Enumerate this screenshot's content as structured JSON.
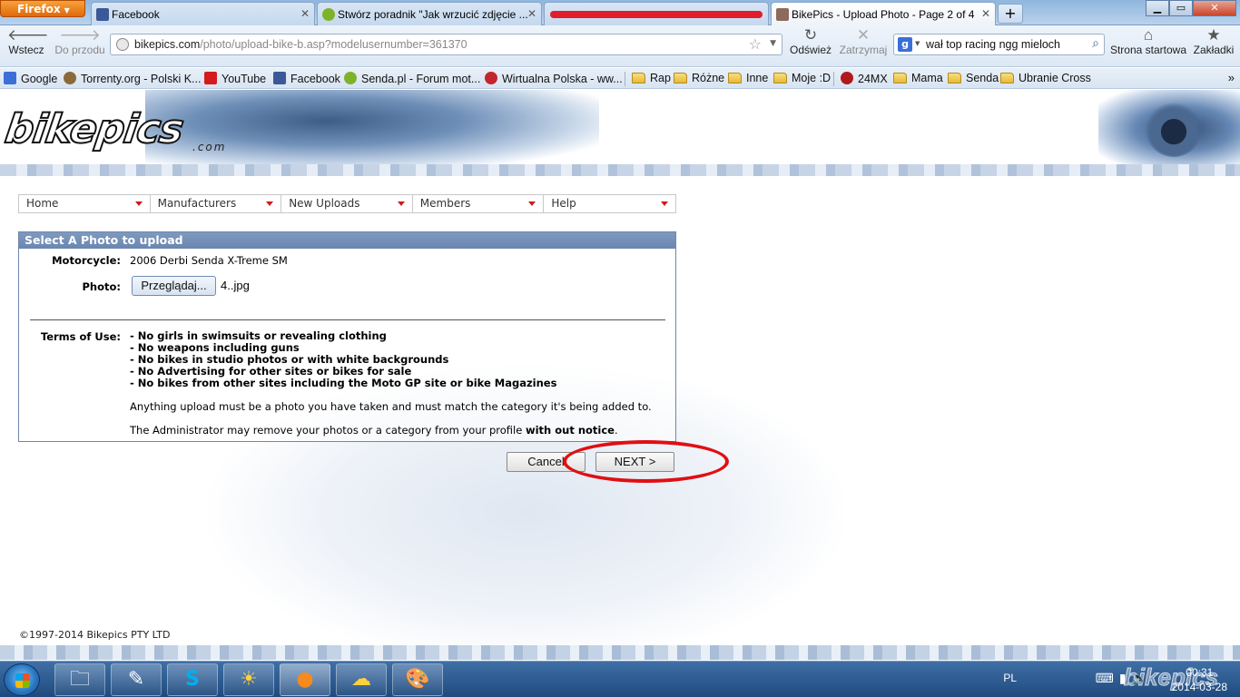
{
  "browser": {
    "app_button": "Firefox",
    "tabs": [
      {
        "title": "Facebook",
        "color": "#3b5998"
      },
      {
        "title": "Stwórz poradnik \"Jak wrzucić zdjęcie ...",
        "color": "#7db32b"
      },
      {
        "title": "",
        "color": "#e01e2c"
      },
      {
        "title": "BikePics - Upload Photo - Page 2 of 4",
        "color": "#8d6b5a"
      }
    ],
    "nav": {
      "back": "Wstecz",
      "forward": "Do przodu",
      "reload": "Odśwież",
      "stop": "Zatrzymaj",
      "home": "Strona startowa",
      "bookmarks": "Zakładki"
    },
    "url_host": "bikepics.com",
    "url_path": "/photo/upload-bike-b.asp?modelusernumber=361370",
    "search_query": "wał top racing ngg mieloch",
    "bookmarks_bar": [
      {
        "label": "Google",
        "icon": "google-icon"
      },
      {
        "label": "Torrenty.org - Polski K...",
        "icon": "torrent-icon"
      },
      {
        "label": "YouTube",
        "icon": "youtube-icon"
      },
      {
        "label": "Facebook",
        "icon": "facebook-icon"
      },
      {
        "label": "Senda.pl - Forum mot...",
        "icon": "senda-icon"
      },
      {
        "label": "Wirtualna Polska - ww...",
        "icon": "wp-icon"
      },
      {
        "label": "Rap",
        "icon": "folder-icon"
      },
      {
        "label": "Różne",
        "icon": "folder-icon"
      },
      {
        "label": "Inne",
        "icon": "folder-icon"
      },
      {
        "label": "Moje :D",
        "icon": "folder-icon"
      },
      {
        "label": "24MX",
        "icon": "24mx-icon"
      },
      {
        "label": "Mama",
        "icon": "folder-icon"
      },
      {
        "label": "Senda",
        "icon": "folder-icon"
      },
      {
        "label": "Ubranie Cross",
        "icon": "folder-icon"
      }
    ]
  },
  "site": {
    "logo": "bikepics",
    "logo_sub": ".com",
    "menu": [
      "Home",
      "Manufacturers",
      "New Uploads",
      "Members",
      "Help"
    ],
    "panel": {
      "heading": "Select A Photo to upload",
      "motorcycle_label": "Motorcycle:",
      "motorcycle_value": "2006 Derbi Senda X-Treme SM",
      "photo_label": "Photo:",
      "browse_button": "Przeglądaj...",
      "file_name": "4..jpg",
      "terms_label": "Terms of Use:",
      "rules": [
        "- No girls in swimsuits or revealing clothing",
        "- No weapons including guns",
        "- No bikes in studio photos or with white backgrounds",
        "- No Advertising for other sites or bikes for sale",
        "- No bikes from other sites including the Moto GP site or bike Magazines"
      ],
      "note1": "Anything upload must be a photo you have taken and must match the category it's being added to.",
      "note2_prefix": "The Administrator may remove your photos or a category from your profile ",
      "note2_bold": "with out notice",
      "note2_suffix": "."
    },
    "cancel_button": "Cancel",
    "next_button": "NEXT >",
    "copyright": "©1997-2014 Bikepics PTY LTD"
  },
  "taskbar": {
    "language": "PL",
    "time": "00:31",
    "date": "2014-03-28",
    "watermark": "bikepics"
  }
}
